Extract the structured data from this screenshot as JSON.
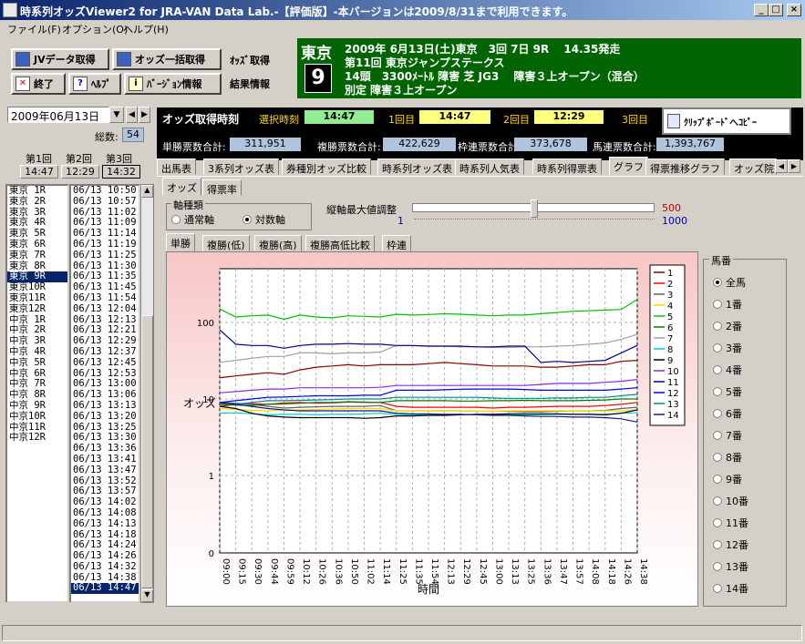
{
  "window": {
    "title": "時系列オッズViewer2 for JRA-VAN Data Lab.-【評価版】-本バージョンは2009/8/31まで利用できます。"
  },
  "menu": {
    "file": "ファイル(F)",
    "option": "オプション(O)",
    "help": "ヘルプ(H)"
  },
  "toolbar": {
    "jv_get": "JVデータ取得",
    "odds_bulk": "オッズ一括取得",
    "odds_get": "ｵｯｽﾞ取得",
    "end": "終了",
    "help": "ﾍﾙﾌﾟ",
    "version": "ﾊﾞｰｼﾞｮﾝ情報",
    "result": "結果情報"
  },
  "race": {
    "venue": "東京",
    "number": "9",
    "line1": "2009年 6月13日(土)東京　3回 7日 9R　 14.35発走",
    "line2": "第11回 東京ジャンプステークス",
    "line3": "14頭　3300ﾒｰﾄﾙ 障害 芝 JG3　 障害３上オープン（混合）",
    "line4": "別定 障害３上オープン"
  },
  "date": {
    "value": "2009年06月13日",
    "total_label": "総数:",
    "total": "54"
  },
  "rounds": {
    "r1": "第1回",
    "r2": "第2回",
    "r3": "第3回",
    "t1": "14:47",
    "t2": "12:29",
    "t3": "14:32"
  },
  "odds_time": {
    "title": "オッズ取得時刻",
    "sel_label": "選択時刻",
    "sel": "14:47",
    "r1_label": "1回目",
    "r1": "14:47",
    "r2_label": "2回目",
    "r2": "12:29",
    "r3_label": "3回目",
    "clipboard": "ｸﾘｯﾌﾟﾎﾞｰﾄﾞへｺﾋﾟｰ"
  },
  "votes": {
    "tan_label": "単勝票数合計:",
    "tan": "311,951",
    "fuku_label": "複勝票数合計:",
    "fuku": "422,629",
    "waku_label": "枠連票数合計:",
    "waku": "373,678",
    "uma_label": "馬連票数合計:",
    "uma": "1,393,767"
  },
  "tabs": [
    "出馬表",
    "3系列オッズ表",
    "券種別オッズ比較",
    "時系列オッズ表",
    "時系列人気表",
    "時系列得票表",
    "グラフ",
    "得票推移グラフ",
    "オッズ院"
  ],
  "subtabs": [
    "オッズ",
    "得票率"
  ],
  "axis_group": {
    "title": "軸種類",
    "normal": "通常軸",
    "log": "対数軸",
    "vmax_label": "縦軸最大値調整",
    "vmax": "500",
    "vmin": "1",
    "vmax2": "1000"
  },
  "bettabs": [
    "単勝",
    "複勝(低)",
    "複勝(高)",
    "複勝高低比較",
    "枠連"
  ],
  "races": [
    "東京 1R",
    "東京 2R",
    "東京 3R",
    "東京 4R",
    "東京 5R",
    "東京 6R",
    "東京 7R",
    "東京 8R",
    "東京 9R",
    "東京10R",
    "東京11R",
    "東京12R",
    "中京 1R",
    "中京 2R",
    "中京 3R",
    "中京 4R",
    "中京 5R",
    "中京 6R",
    "中京 7R",
    "中京 8R",
    "中京 9R",
    "中京10R",
    "中京11R",
    "中京12R"
  ],
  "times": [
    "06/13 10:50",
    "06/13 10:57",
    "06/13 11:02",
    "06/13 11:09",
    "06/13 11:14",
    "06/13 11:19",
    "06/13 11:25",
    "06/13 11:30",
    "06/13 11:35",
    "06/13 11:45",
    "06/13 11:54",
    "06/13 12:04",
    "06/13 12:13",
    "06/13 12:21",
    "06/13 12:29",
    "06/13 12:37",
    "06/13 12:45",
    "06/13 12:53",
    "06/13 13:00",
    "06/13 13:06",
    "06/13 13:13",
    "06/13 13:20",
    "06/13 13:25",
    "06/13 13:30",
    "06/13 13:36",
    "06/13 13:41",
    "06/13 13:47",
    "06/13 13:52",
    "06/13 13:57",
    "06/13 14:02",
    "06/13 14:08",
    "06/13 14:13",
    "06/13 14:18",
    "06/13 14:24",
    "06/13 14:26",
    "06/13 14:32",
    "06/13 14:38",
    "06/13 14:47"
  ],
  "horse_group": {
    "title": "馬番",
    "items": [
      "全馬",
      "1番",
      "2番",
      "3番",
      "4番",
      "5番",
      "6番",
      "7番",
      "8番",
      "9番",
      "10番",
      "11番",
      "12番",
      "13番",
      "14番"
    ]
  },
  "chart_data": {
    "type": "line",
    "xlabel": "時間",
    "ylabel": "オッズ",
    "yscale": "log",
    "yticks": [
      "0",
      "1",
      "10",
      "100"
    ],
    "x": [
      "09:00",
      "09:15",
      "09:30",
      "09:44",
      "09:59",
      "10:12",
      "10:26",
      "10:36",
      "10:50",
      "11:02",
      "11:14",
      "11:25",
      "11:35",
      "11:54",
      "12:13",
      "12:29",
      "12:45",
      "13:00",
      "13:13",
      "13:25",
      "13:36",
      "13:47",
      "13:57",
      "14:08",
      "14:18",
      "14:26",
      "14:38"
    ],
    "grid": true,
    "legend": "top-right",
    "series": [
      {
        "name": "1",
        "color": "#8b0000",
        "values": [
          19,
          20,
          21,
          22,
          21,
          24,
          26,
          27,
          28,
          27,
          28,
          28,
          28,
          29,
          30,
          29,
          28,
          27,
          27,
          27,
          26,
          26,
          27,
          28,
          28,
          31,
          32
        ]
      },
      {
        "name": "2",
        "color": "#ff0000",
        "values": [
          8,
          8.5,
          8.7,
          8.5,
          8.9,
          9,
          8.8,
          8.9,
          9.1,
          9,
          9,
          8,
          7.8,
          7.8,
          7.8,
          7.8,
          7.8,
          7.6,
          7.8,
          7.8,
          7.9,
          8,
          8,
          8,
          8.2,
          8.5,
          9
        ]
      },
      {
        "name": "3",
        "color": "#606060",
        "values": [
          9,
          8.8,
          8.5,
          8,
          7.6,
          7.8,
          7.9,
          8,
          8,
          8,
          8.2,
          7,
          7,
          7,
          7,
          7,
          6.9,
          6.9,
          6.9,
          6.8,
          6.8,
          6.9,
          7,
          7,
          7.1,
          7.5,
          7.8
        ]
      },
      {
        "name": "4",
        "color": "#ffd700",
        "values": [
          7.5,
          7.3,
          7.1,
          7,
          7.2,
          7.2,
          7.3,
          7.4,
          7.5,
          7.5,
          7.5,
          7,
          7,
          7,
          7,
          7,
          6.9,
          6.9,
          7,
          7,
          7,
          7,
          7,
          7,
          7,
          7,
          7.2
        ]
      },
      {
        "name": "5",
        "color": "#00c000",
        "values": [
          150,
          118,
          122,
          125,
          110,
          125,
          118,
          115,
          122,
          120,
          118,
          128,
          125,
          127,
          130,
          128,
          125,
          122,
          125,
          125,
          130,
          135,
          140,
          142,
          145,
          148,
          200
        ]
      },
      {
        "name": "6",
        "color": "#008000",
        "values": [
          8.5,
          8.3,
          8.2,
          8.5,
          8.6,
          8.8,
          9,
          9,
          9.2,
          9.1,
          9,
          9.5,
          9.5,
          9.5,
          9.5,
          9.4,
          9.4,
          9.5,
          9.5,
          9.6,
          9.5,
          9.5,
          9.5,
          9.6,
          9.7,
          10,
          10
        ]
      },
      {
        "name": "7",
        "color": "#a0a0a0",
        "values": [
          30,
          32,
          34,
          36,
          36,
          40,
          40,
          39,
          40,
          40,
          41,
          50,
          50,
          49,
          49,
          48,
          48,
          47,
          47,
          48,
          48,
          49,
          50,
          52,
          54,
          60,
          70
        ]
      },
      {
        "name": "8",
        "color": "#00ced1",
        "values": [
          6.5,
          6.6,
          6.4,
          6.2,
          6.3,
          6.3,
          6.2,
          6.3,
          6.3,
          6.4,
          6.5,
          6.3,
          6.2,
          6.2,
          6.2,
          6.2,
          6.2,
          6.2,
          6.2,
          6.2,
          6.2,
          6.3,
          6.3,
          6.3,
          6.3,
          6.5,
          6.6
        ]
      },
      {
        "name": "9",
        "color": "#000000",
        "values": [
          8,
          7.5,
          6.5,
          6,
          5.8,
          5.7,
          5.7,
          5.7,
          5.7,
          5.6,
          5.7,
          6,
          6,
          6.1,
          6.1,
          6.2,
          6.3,
          6.3,
          6.4,
          6.4,
          6.4,
          6.4,
          6.3,
          6.3,
          6.2,
          6.5,
          7.2
        ]
      },
      {
        "name": "10",
        "color": "#8a2be2",
        "values": [
          12,
          12.5,
          13,
          13.5,
          13.5,
          14,
          14,
          14,
          14,
          14,
          14.2,
          15,
          15,
          15,
          15,
          15,
          15,
          15,
          15,
          15,
          15.5,
          16,
          16,
          16,
          16.5,
          17,
          18
        ]
      },
      {
        "name": "11",
        "color": "#00008b",
        "values": [
          80,
          52,
          50,
          50,
          46,
          50,
          52,
          52,
          53,
          52,
          52,
          50,
          50,
          49,
          49,
          49,
          48,
          48,
          49,
          49,
          30,
          31,
          30,
          31,
          32,
          40,
          50
        ]
      },
      {
        "name": "12",
        "color": "#0000ff",
        "values": [
          9,
          9.5,
          10,
          10.5,
          10.6,
          10.8,
          11,
          11,
          11,
          11.2,
          11.2,
          13,
          13,
          13,
          13.2,
          13.4,
          13.5,
          13.5,
          13.5,
          13.3,
          13,
          13,
          13,
          13,
          13,
          13.5,
          14
        ]
      },
      {
        "name": "13",
        "color": "#008b8b",
        "values": [
          8.8,
          8.5,
          9,
          9.5,
          9.5,
          9.6,
          9.7,
          9.8,
          10,
          10,
          10,
          10.5,
          10.5,
          10.5,
          10.5,
          10.5,
          10.5,
          10.3,
          10.2,
          10.2,
          10.2,
          10.3,
          10.3,
          10.5,
          10.5,
          11,
          11.5
        ]
      },
      {
        "name": "14",
        "color": "#191970",
        "values": [
          9,
          8.5,
          8,
          7.5,
          7.2,
          7,
          7,
          7,
          7,
          7,
          7,
          6.5,
          6.4,
          6.4,
          6.3,
          6.3,
          6.2,
          6.1,
          6.1,
          6,
          5.9,
          5.9,
          5.8,
          5.8,
          5.7,
          5.5,
          5
        ]
      }
    ]
  }
}
